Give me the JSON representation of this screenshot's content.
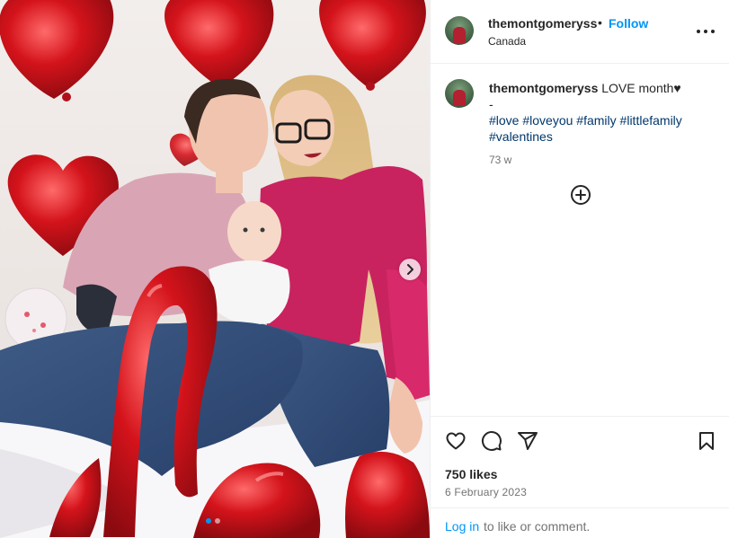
{
  "post": {
    "username": "themontgomeryss",
    "location": "Canada",
    "follow_label": "Follow",
    "bullet": "•"
  },
  "caption": {
    "username": "themontgomeryss",
    "text": "LOVE month♥",
    "dash": "-",
    "hashtags": [
      "#love",
      "#loveyou",
      "#family",
      "#littlefamily",
      "#valentines"
    ],
    "time": "73 w"
  },
  "engagement": {
    "likes": "750 likes",
    "date": "6 February 2023"
  },
  "login": {
    "link": "Log in",
    "rest": "to like or comment."
  },
  "carousel": {
    "slide_count": 2,
    "current_slide": 1
  },
  "icons": {
    "more": "more-options-icon",
    "add_comment": "plus-circle-icon",
    "like": "heart-icon",
    "comment": "comment-icon",
    "share": "share-icon",
    "save": "bookmark-icon",
    "next": "chevron-right-icon"
  },
  "colors": {
    "accent": "#0095f6",
    "hashtag": "#00376b",
    "secondary_text": "#737373",
    "balloon_red": "#d4131b"
  }
}
